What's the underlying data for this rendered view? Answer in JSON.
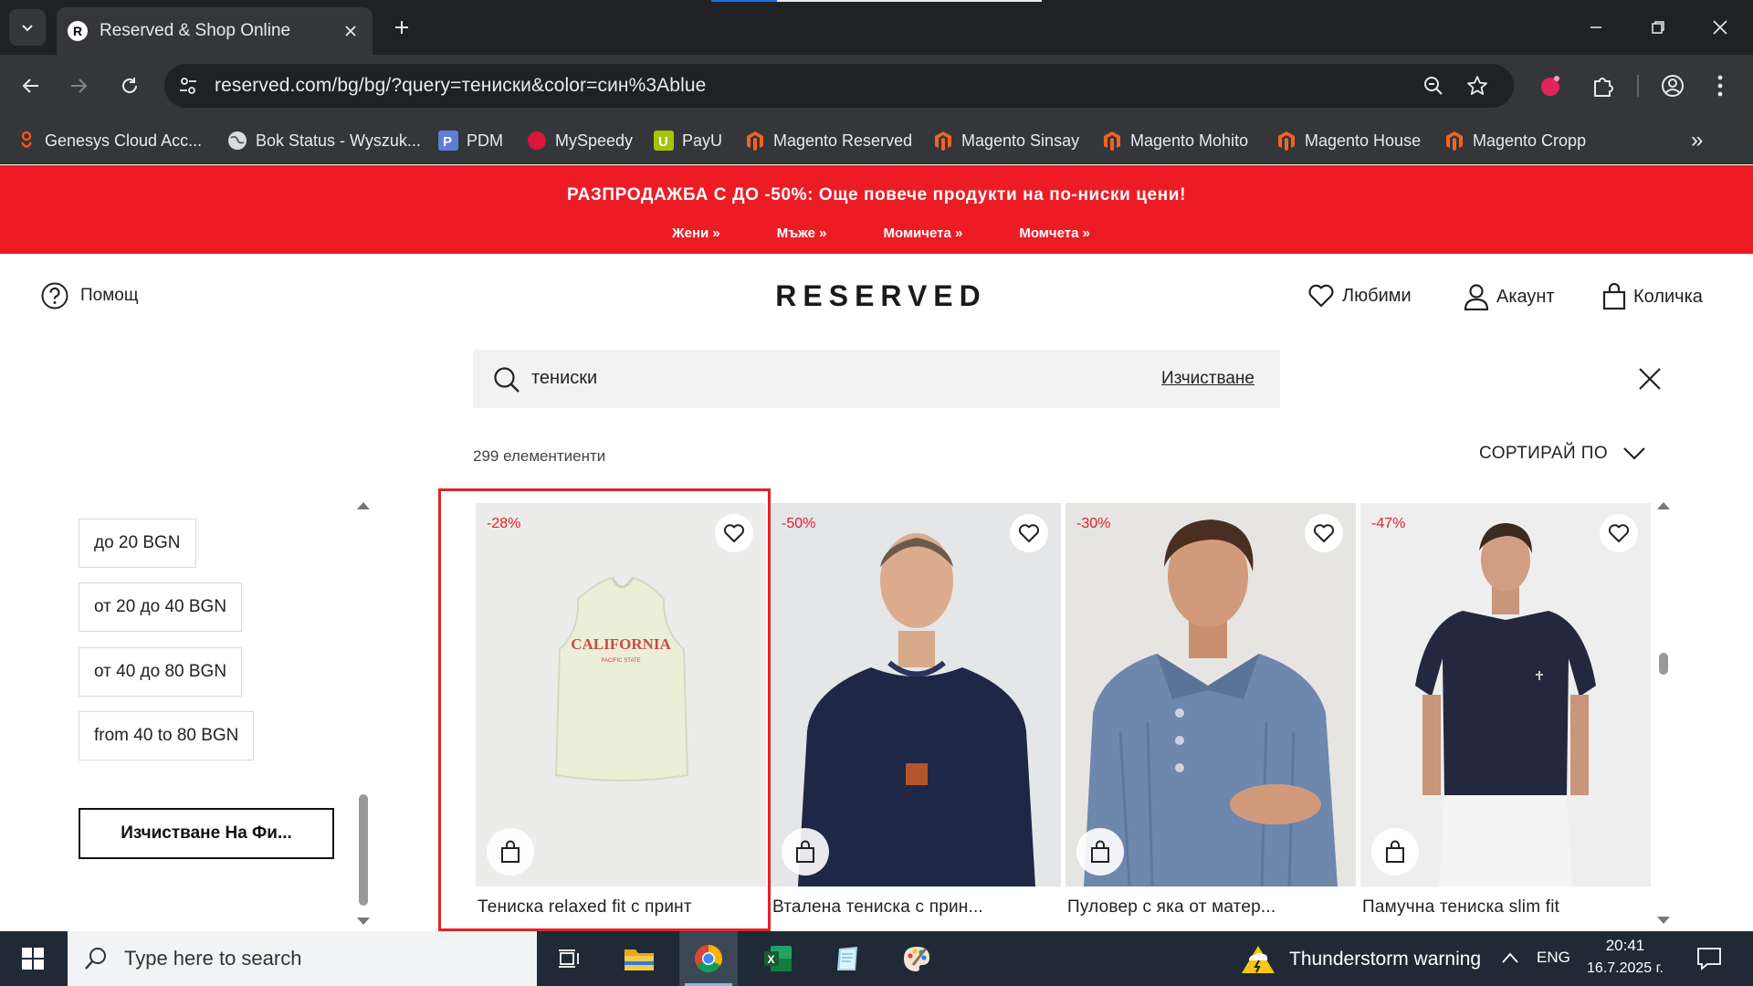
{
  "browser": {
    "tab_title": "Reserved & Shop Online",
    "favicon_letter": "R",
    "url": "reserved.com/bg/bg/?query=тениски&color=син%3Ablue",
    "bookmarks": [
      {
        "label": "Genesys Cloud Acc..."
      },
      {
        "label": "Bok Status - Wyszuk..."
      },
      {
        "label": "PDM"
      },
      {
        "label": "MySpeedy"
      },
      {
        "label": "PayU"
      },
      {
        "label": "Magento Reserved"
      },
      {
        "label": "Magento Sinsay"
      },
      {
        "label": "Magento Mohito"
      },
      {
        "label": "Magento House"
      },
      {
        "label": "Magento Cropp"
      }
    ],
    "bookmarks_more": "»"
  },
  "promo": {
    "headline": "РАЗПРОДАЖБА С ДО -50%: Още повече продукти на по-ниски цени!",
    "links": [
      "Жени »",
      "Мъже »",
      "Момичета »",
      "Момчета »"
    ],
    "background": "#ed1c24"
  },
  "header": {
    "help": "Помощ",
    "logo": "RESERVED",
    "favorites": "Любими",
    "account": "Акаунт",
    "cart": "Количка"
  },
  "search": {
    "query": "тениски",
    "clear": "Изчистване"
  },
  "results": {
    "count": "299 елементиенти",
    "sort": "СОРТИРАЙ ПО"
  },
  "filters": {
    "price_options": [
      "до 20 BGN",
      "от 20 до 40 BGN",
      "от 40 до 80 BGN",
      "from 40 to 80 BGN"
    ],
    "clear_all": "Изчистване На Фи..."
  },
  "products": [
    {
      "name": "Тениска relaxed fit с принт",
      "discount": "-28%"
    },
    {
      "name": "Вталена тениска с прин...",
      "discount": "-50%"
    },
    {
      "name": "Пуловер с яка от матер...",
      "discount": "-30%"
    },
    {
      "name": "Памучна тениска slim fit",
      "discount": "-47%"
    }
  ],
  "taskbar": {
    "search_placeholder": "Type here to search",
    "weather": "Thunderstorm warning",
    "language": "ENG",
    "time": "20:41",
    "date": "16.7.2025 г."
  }
}
